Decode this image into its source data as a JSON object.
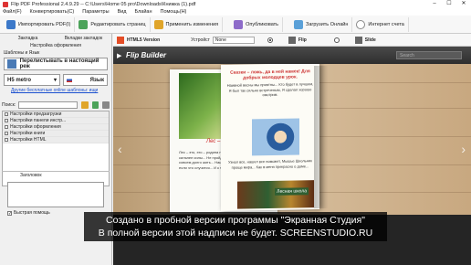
{
  "window": {
    "title": "Flip PDF Professional 2.4.9.29 -- C:\\Users\\Home 05 pro\\Downloads\\Книжка (1).pdf",
    "controls": [
      "–",
      "☐",
      "✕"
    ]
  },
  "menu": [
    "Файл(F)",
    "Конвертировать(C)",
    "Параметры",
    "Вид",
    "Блайан",
    "Помощь(H)"
  ],
  "toolbar": {
    "import": "Импортировать PDF(I)",
    "edit": "Редактировать страниц",
    "apply": "Применить изменения",
    "publish": "Опубликовать",
    "upload": "Загрузить Онлайн",
    "cloud": "Интернет счета"
  },
  "left": {
    "tab_bookmarks": "Закладка",
    "tab_bookmarks2": "Вкладки закладок",
    "subtitle": "Настройка оформления",
    "templates_label": "Шаблоны и Язык",
    "theme": "Перелистывать в настоящий реж",
    "version": "H5 metro",
    "language": "Язык",
    "more_themes": "Другие бесплатные online шаблоны: ищи",
    "search_label": "Поиск:",
    "tree": [
      "Настройки предзагрузки",
      "Настройки панели инстр...",
      "Настройки оформления",
      "Настройки книги",
      "Настройки HTML"
    ],
    "title_label": "Заголовок",
    "quick_help": "Быстрая помощь"
  },
  "preview": {
    "html5": "HTML5 Version",
    "device_label": "Устройст",
    "device": "None",
    "flip": "Flip",
    "slide": "Slide",
    "search": "Search"
  },
  "flipbook": {
    "logo": "Flip Builder",
    "left_caption": "Лес – это...",
    "left_text": "Лес – это, это – родина наших предков... Не бывает сильнее силы... Не пройдёт спешит... И ещё... Так совсем долго жить... Наше... И ещё... Подобно то, если что случится... И к тому же оно совсем...",
    "right_heading": "Сказки – ложь, да в ней намек! Для добрых молодцев урок.",
    "right_text1": "Наивной весны мы приятны... Кто будет в лучшем, Я был так сильно встреченым, Я сделал хорошо смотрим.",
    "right_text2": "Узнал все, нашел все поможет, Мышье Школьник проще мира... Как в меня прекрасно о доме...",
    "right_pic_label": "Лесная школа"
  },
  "watermark": {
    "line1": "Создано в пробной версии программы \"Экранная Студия\"",
    "line2": "В полной версии этой надписи не будет. SCREENSTUDIO.RU"
  }
}
